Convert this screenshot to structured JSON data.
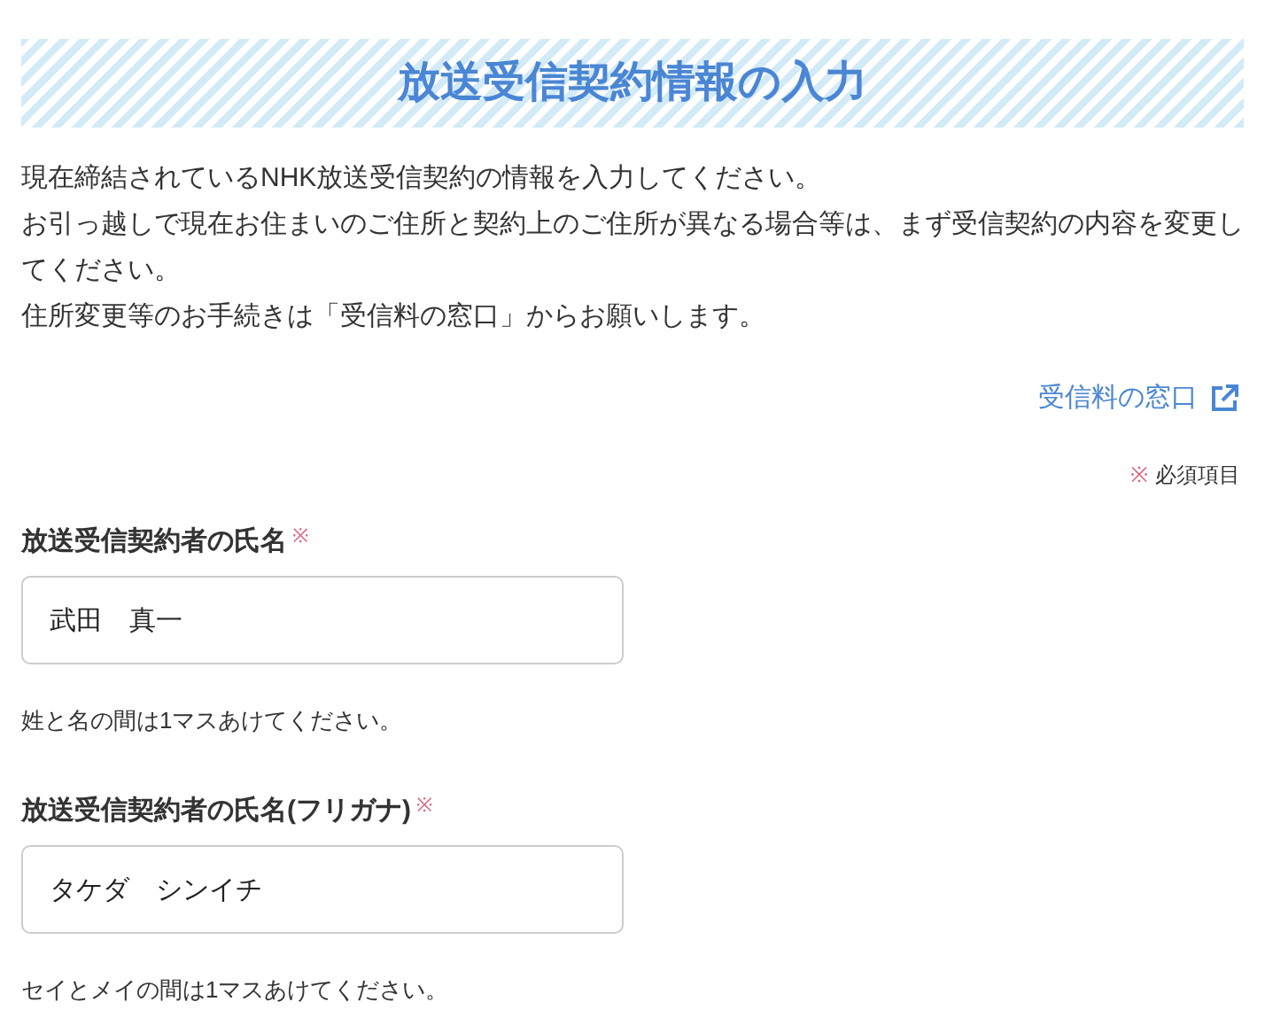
{
  "title": "放送受信契約情報の入力",
  "intro": [
    "現在締結されているNHK放送受信契約の情報を入力してください。",
    "お引っ越しで現在お住まいのご住所と契約上のご住所が異なる場合等は、まず受信契約の内容を変更してください。",
    "住所変更等のお手続きは「受信料の窓口」からお願いします。"
  ],
  "external_link": {
    "label": "受信料の窓口"
  },
  "required_note": {
    "mark": "※",
    "label": "必須項目"
  },
  "fields": [
    {
      "label": "放送受信契約者の氏名",
      "required": true,
      "required_mark": "※",
      "value": "武田　真一",
      "hint": "姓と名の間は1マスあけてください。"
    },
    {
      "label": "放送受信契約者の氏名(フリガナ)",
      "required": true,
      "required_mark": "※",
      "value": "タケダ　シンイチ",
      "hint": "セイとメイの間は1マスあけてください。"
    }
  ]
}
